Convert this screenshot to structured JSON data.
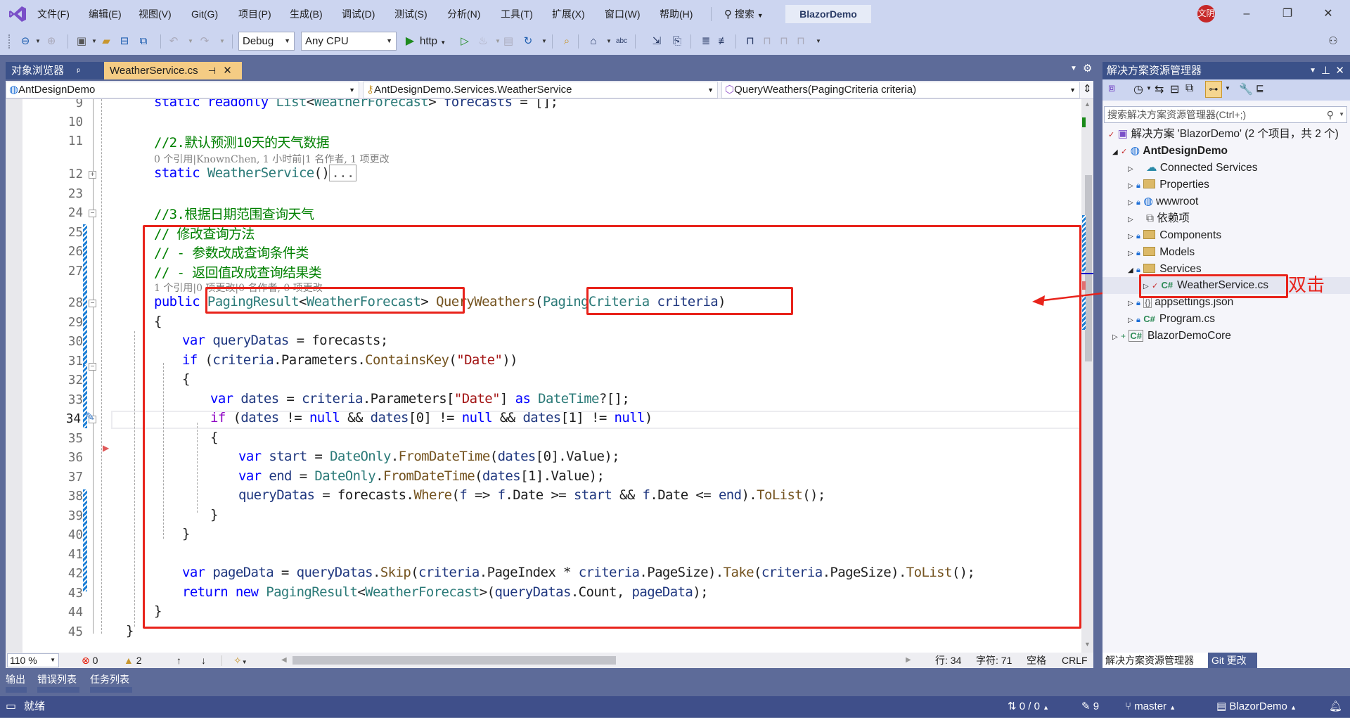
{
  "titlebar": {
    "menu": [
      "文件(F)",
      "编辑(E)",
      "视图(V)",
      "Git(G)",
      "项目(P)",
      "生成(B)",
      "调试(D)",
      "测试(S)",
      "分析(N)",
      "工具(T)",
      "扩展(X)",
      "窗口(W)",
      "帮助(H)"
    ],
    "search_label": "搜索",
    "app_name": "BlazorDemo",
    "avatar_text": "文阴",
    "minimize": "–",
    "restore": "❐",
    "close": "✕"
  },
  "toolbar": {
    "config": "Debug",
    "platform": "Any CPU",
    "run_target": "http"
  },
  "doc_tabs": [
    {
      "label": "对象浏览器",
      "pin": "ᵖ",
      "active": false
    },
    {
      "label": "WeatherService.cs",
      "pin": "⊣",
      "close": "✕",
      "active": true
    }
  ],
  "navbar": {
    "project": "AntDesignDemo",
    "class": "AntDesignDemo.Services.WeatherService",
    "member": "QueryWeathers(PagingCriteria criteria)"
  },
  "editor": {
    "line_numbers": [
      "9",
      "10",
      "11",
      "12",
      "23",
      "24",
      "25",
      "26",
      "27",
      "28",
      "29",
      "30",
      "31",
      "32",
      "33",
      "34",
      "35",
      "36",
      "37",
      "38",
      "39",
      "40",
      "41",
      "42",
      "43",
      "44",
      "45"
    ],
    "codelens": [
      "0 个引用|KnownChen, 1 小时前|1 名作者, 1 项更改",
      "1 个引用|0 项更改|0 名作者, 0 项更改"
    ],
    "current_line": "34"
  },
  "annotation": {
    "double_click_label": "双击"
  },
  "editor_status": {
    "zoom": "110 %",
    "errors": "0",
    "warnings": "2",
    "line": "行: 34",
    "char": "字符: 71",
    "indent": "空格",
    "eol": "CRLF"
  },
  "tool_tabs": [
    "输出",
    "错误列表",
    "任务列表"
  ],
  "statusbar": {
    "ready": "就绪",
    "sync": "0 / 0",
    "pending": "9",
    "branch": "master",
    "repo": "BlazorDemo"
  },
  "solution_explorer": {
    "title": "解决方案资源管理器",
    "search_placeholder": "搜索解决方案资源管理器(Ctrl+;)",
    "solution": "解决方案 'BlazorDemo' (2 个项目，共 2 个)",
    "project": "AntDesignDemo",
    "items": [
      "Connected Services",
      "Properties",
      "wwwroot",
      "依赖项",
      "Components",
      "Models",
      "Services",
      "WeatherService.cs",
      "appsettings.json",
      "Program.cs"
    ],
    "project2": "BlazorDemoCore",
    "bottom_tabs": [
      "解决方案资源管理器",
      "Git 更改"
    ]
  }
}
